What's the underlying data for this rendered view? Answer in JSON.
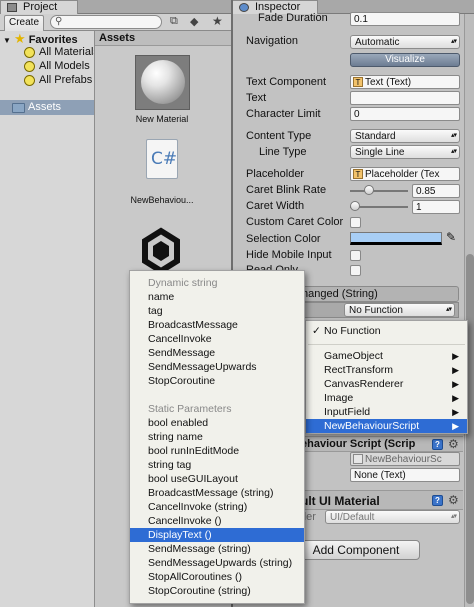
{
  "project_tab": {
    "title": "Project"
  },
  "inspector_tab": {
    "title": "Inspector"
  },
  "project_toolbar": {
    "create_label": "Create ▾"
  },
  "favorites": {
    "title": "Favorites",
    "items": [
      "All Materials",
      "All Models",
      "All Prefabs"
    ]
  },
  "assets_root": {
    "label": "Assets"
  },
  "assets_header": {
    "label": "Assets"
  },
  "assets": [
    {
      "name": "New Material",
      "icon": "material-sphere-icon"
    },
    {
      "name": "NewBehaviou...",
      "icon": "csharp-script-icon"
    },
    {
      "name": "",
      "icon": "unity-logo-icon"
    }
  ],
  "inspector": {
    "fade_duration": {
      "label": "Fade Duration",
      "value": "0.1"
    },
    "navigation": {
      "label": "Navigation",
      "value": "Automatic",
      "visualize": "Visualize"
    },
    "text_component": {
      "label": "Text Component",
      "value": "Text (Text)"
    },
    "text": {
      "label": "Text"
    },
    "character_limit": {
      "label": "Character Limit",
      "value": "0"
    },
    "content_type": {
      "label": "Content Type",
      "value": "Standard"
    },
    "line_type": {
      "label": "Line Type",
      "value": "Single Line"
    },
    "placeholder": {
      "label": "Placeholder",
      "value": "Placeholder (Tex"
    },
    "caret_blink_rate": {
      "label": "Caret Blink Rate",
      "value": "0.85",
      "fraction": 0.3
    },
    "caret_width": {
      "label": "Caret Width",
      "value": "1",
      "fraction": 0.2
    },
    "custom_caret_color": {
      "label": "Custom Caret Color"
    },
    "selection_color": {
      "label": "Selection Color",
      "color": "#a8cef5"
    },
    "hide_mobile_input": {
      "label": "Hide Mobile Input"
    },
    "read_only": {
      "label": "Read Only"
    },
    "event_header": "hanged (String)",
    "no_function": "No Function",
    "behaviour_script": {
      "label": "ehaviour Script (Scrip",
      "script_value": "NewBehaviourSc",
      "object_value": "None (Text)"
    },
    "ui_material": {
      "label": "ult UI Material",
      "shader_label": "der",
      "shader_value": "UI/Default"
    },
    "add_component": "Add Component"
  },
  "component_menu": {
    "items": [
      {
        "label": "No Function",
        "checked": true,
        "submenu": false
      },
      {
        "label": "GameObject",
        "submenu": true
      },
      {
        "label": "RectTransform",
        "submenu": true
      },
      {
        "label": "CanvasRenderer",
        "submenu": true
      },
      {
        "label": "Image",
        "submenu": true
      },
      {
        "label": "InputField",
        "submenu": true
      },
      {
        "label": "NewBehaviourScript",
        "submenu": true,
        "selected": true
      }
    ]
  },
  "method_menu": {
    "dynamic_header": "Dynamic string",
    "dynamic_items": [
      "name",
      "tag",
      "BroadcastMessage",
      "CancelInvoke",
      "SendMessage",
      "SendMessageUpwards",
      "StopCoroutine"
    ],
    "static_header": "Static Parameters",
    "static_items": [
      "bool enabled",
      "string name",
      "bool runInEditMode",
      "string tag",
      "bool useGUILayout",
      "BroadcastMessage (string)",
      "CancelInvoke (string)",
      "CancelInvoke ()",
      "DisplayText ()",
      "SendMessage (string)",
      "SendMessageUpwards (string)",
      "StopAllCoroutines ()",
      "StopCoroutine (string)"
    ],
    "selected": "DisplayText ()"
  },
  "colors": {
    "menu_selection": "#2e6cd4",
    "menu_bg": "#f1f1eb",
    "panel_bg": "#c2c2c2"
  }
}
